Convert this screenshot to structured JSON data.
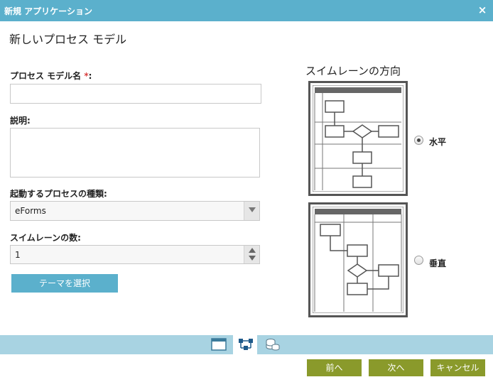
{
  "dialog": {
    "title": "新規 アプリケーション",
    "close": "×"
  },
  "page": {
    "heading": "新しいプロセス モデル"
  },
  "form": {
    "name_label": "プロセス モデル名",
    "name_required": "*",
    "name_colon": ":",
    "name_value": "",
    "description_label": "説明:",
    "description_value": "",
    "process_type_label": "起動するプロセスの種類:",
    "process_type_value": "eForms",
    "swimlane_count_label": "スイムレーンの数:",
    "swimlane_count_value": "1",
    "theme_button": "テーマを選択"
  },
  "orientation": {
    "heading": "スイムレーンの方向",
    "options": [
      {
        "label": "水平",
        "checked": true,
        "icon": "horizontal-swimlane-diagram"
      },
      {
        "label": "垂直",
        "checked": false,
        "icon": "vertical-swimlane-diagram"
      }
    ]
  },
  "tabs": [
    {
      "icon": "window-icon",
      "active": false
    },
    {
      "icon": "process-flow-icon",
      "active": true
    },
    {
      "icon": "database-icon",
      "active": false
    }
  ],
  "footer": {
    "prev": "前へ",
    "next": "次へ",
    "cancel": "キャンセル"
  },
  "colors": {
    "titlebar": "#5bb0cc",
    "tabbar": "#a8d3e2",
    "footer_button": "#8a9a2b",
    "theme_button": "#5bb0cc",
    "required": "#d94040"
  }
}
